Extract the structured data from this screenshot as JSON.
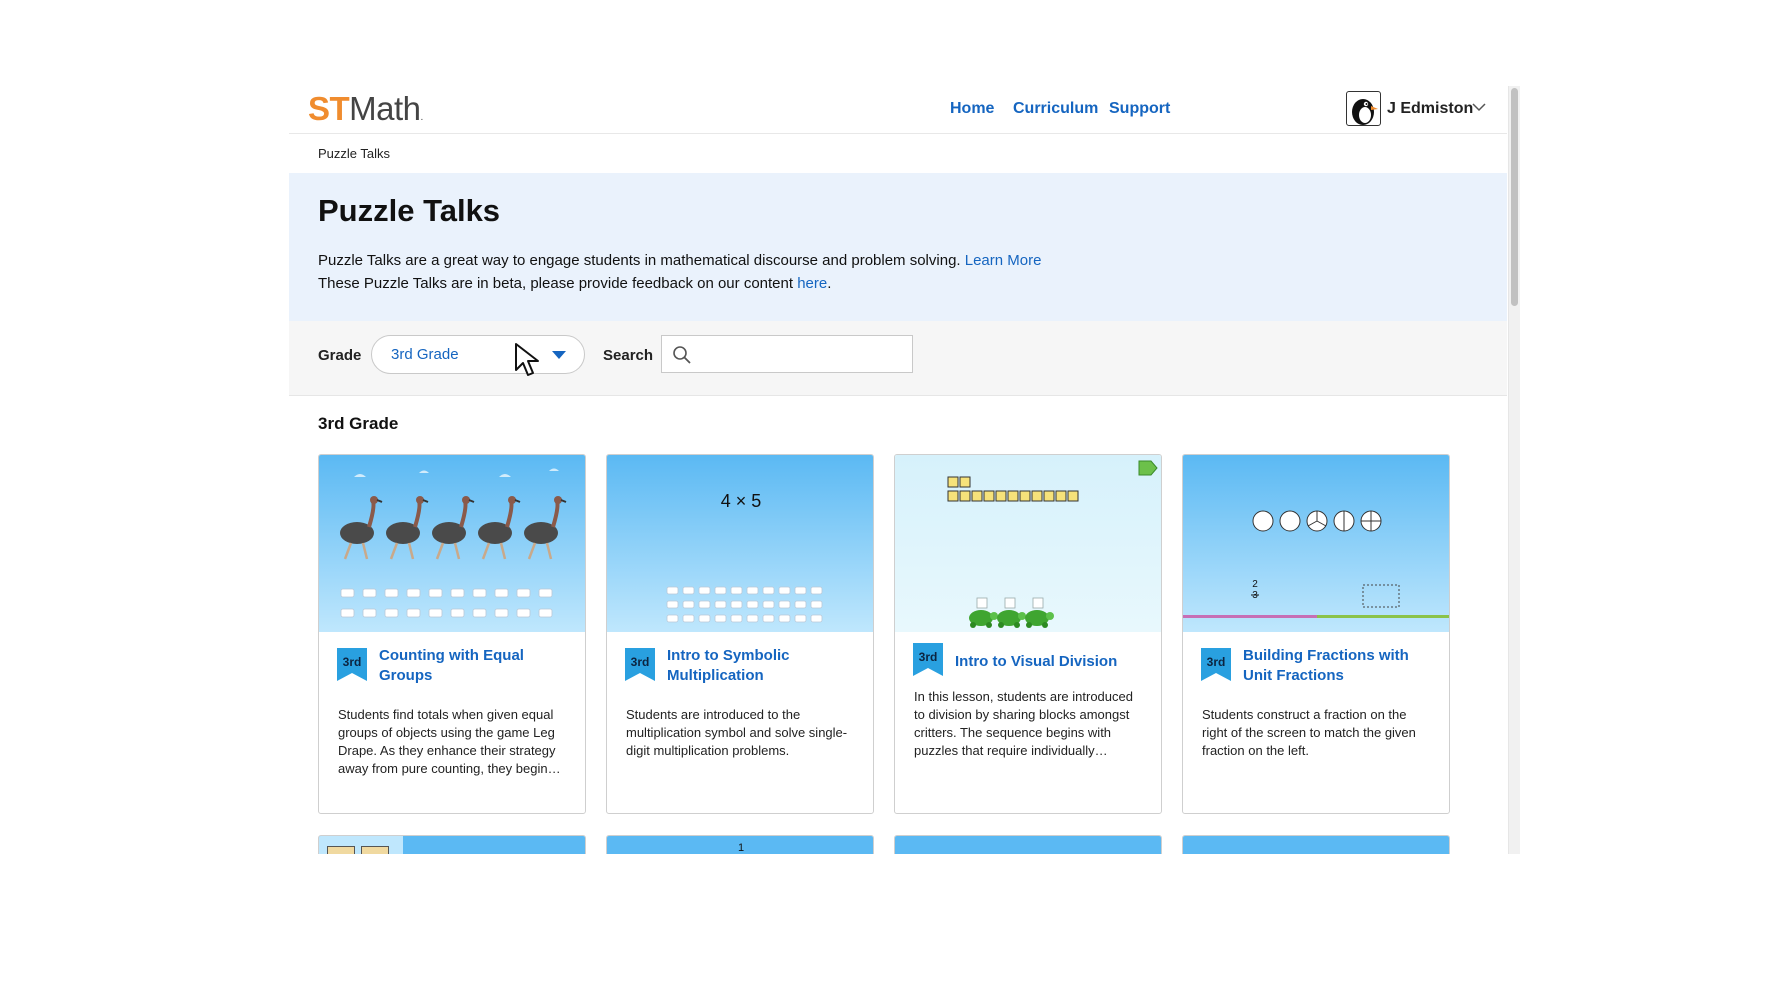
{
  "header": {
    "logo_st": "ST",
    "logo_math": "Math",
    "nav": [
      "Home",
      "Curriculum",
      "Support"
    ],
    "user_name": "J Edmiston",
    "avatar_icon": "penguin-avatar-icon"
  },
  "breadcrumb": "Puzzle Talks",
  "banner": {
    "title": "Puzzle Talks",
    "line1_text": "Puzzle Talks are a great way to engage students in mathematical discourse and problem solving.",
    "line1_link": "Learn More",
    "line2_text": "These Puzzle Talks are in beta, please provide feedback on our content",
    "line2_link": "here",
    "line2_end": "."
  },
  "filters": {
    "grade_label": "Grade",
    "grade_value": "3rd Grade",
    "search_label": "Search",
    "search_placeholder": "",
    "search_value": ""
  },
  "section_title": "3rd Grade",
  "cards": [
    {
      "grade": "3rd",
      "title": "Counting with Equal Groups",
      "description": "Students find totals when given equal groups of objects using the game Leg Drape. As they enhance their strategy away from pure counting, they begin…"
    },
    {
      "grade": "3rd",
      "title": "Intro to Symbolic Multiplication",
      "description": "Students are introduced to the multiplication symbol and solve single-digit multiplication problems.",
      "thumb_text": "4 × 5"
    },
    {
      "grade": "3rd",
      "title": "Intro to Visual Division",
      "description": "In this lesson, students are introduced to division by sharing blocks amongst critters. The sequence begins with puzzles that require individually…"
    },
    {
      "grade": "3rd",
      "title": "Building Fractions with Unit Fractions",
      "description": "Students construct a fraction on the right of the screen to match the given fraction on the left.",
      "fraction_num": "2",
      "fraction_den": "3"
    }
  ],
  "row2_thumb_text": "1",
  "colors": {
    "accent": "#1565c0",
    "logo_orange": "#f08c2e",
    "banner_bg": "#eaf2fc",
    "badge_blue": "#29a0e0"
  }
}
